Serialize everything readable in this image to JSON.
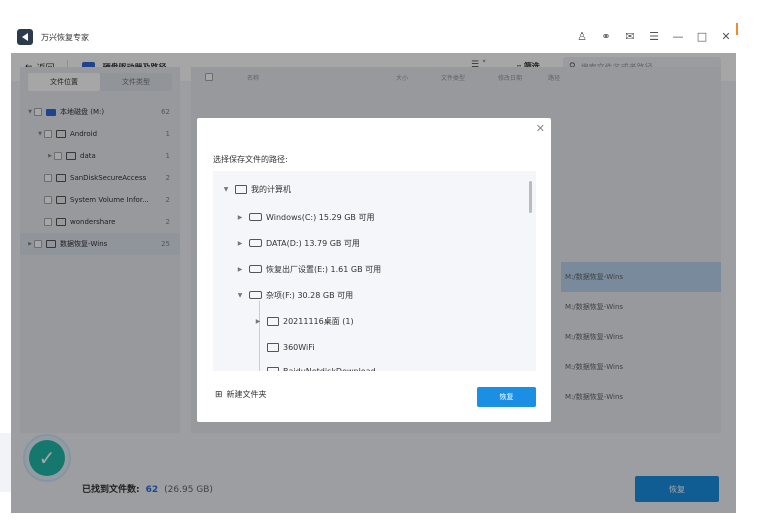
{
  "app": {
    "title": "万兴恢复专家"
  },
  "window_controls": [
    "person-icon",
    "headset-icon",
    "mail-icon",
    "menu-icon",
    "minimize-icon",
    "maximize-icon",
    "close-icon"
  ],
  "toolbar": {
    "back_label": "返回",
    "breadcrumb": "硬盘驱动器及路径",
    "filter_label": "筛选",
    "search_placeholder": "搜索文件名或者路径"
  },
  "left_panel": {
    "tabs": [
      {
        "label": "文件位置",
        "active": true
      },
      {
        "label": "文件类型",
        "active": false
      }
    ],
    "tree": [
      {
        "label": "本地磁盘 (M:)",
        "count": "62",
        "icon": "drive",
        "level": 0,
        "expanded": true
      },
      {
        "label": "Android",
        "count": "1",
        "icon": "folder",
        "level": 1,
        "expanded": true
      },
      {
        "label": "data",
        "count": "1",
        "icon": "folder",
        "level": 2,
        "expanded": false
      },
      {
        "label": "SanDiskSecureAccess",
        "count": "2",
        "icon": "folder",
        "level": 1,
        "expanded": null
      },
      {
        "label": "System Volume Infor...",
        "count": "2",
        "icon": "folder",
        "level": 1,
        "expanded": null
      },
      {
        "label": "wondershare",
        "count": "2",
        "icon": "folder",
        "level": 1,
        "expanded": null
      },
      {
        "label": "数据恢复-Wins",
        "count": "25",
        "icon": "folder",
        "level": 0,
        "expanded": false,
        "selected": true
      }
    ]
  },
  "table": {
    "headers": [
      "名称",
      "大小",
      "文件类型",
      "修改日期",
      "路径"
    ],
    "paths": [
      "M:/数据恢复-Wins",
      "M:/数据恢复-Wins",
      "M:/数据恢复-Wins",
      "M:/数据恢复-Wins",
      "M:/数据恢复-Wins"
    ]
  },
  "status": {
    "found_label": "已找到文件数:",
    "found_count": "62",
    "found_size": "(26.95 GB)",
    "recover_label": "恢复"
  },
  "dialog": {
    "label": "选择保存文件的路径:",
    "tree": [
      {
        "label": "我的计算机",
        "icon": "computer",
        "expanded": true
      },
      {
        "label": "Windows(C:)  15.29 GB 可用",
        "icon": "drive",
        "expanded": false
      },
      {
        "label": "DATA(D:)  13.79 GB 可用",
        "icon": "drive",
        "expanded": false
      },
      {
        "label": "恢复出厂设置(E:)  1.61 GB 可用",
        "icon": "drive",
        "expanded": false
      },
      {
        "label": "杂项(F:)  30.28 GB 可用",
        "icon": "drive",
        "expanded": true
      },
      {
        "label": "20211116桌面 (1)",
        "icon": "folder",
        "expanded": false
      },
      {
        "label": "360WiFi",
        "icon": "folder",
        "expanded": null
      },
      {
        "label": "BaiduNetdiskDownload",
        "icon": "folder",
        "expanded": null
      }
    ],
    "new_folder_label": "新建文件夹",
    "recover_label": "恢复"
  },
  "colors": {
    "accent": "#1a8fe3",
    "selected_row": "#b8d4ef",
    "success": "#1fb8aa"
  }
}
